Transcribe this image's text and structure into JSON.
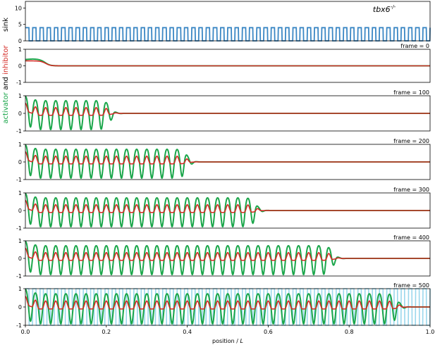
{
  "title": "tbx6",
  "title_superscript": "-/-",
  "colors": {
    "sink": "#3b87c4",
    "sink_light": "#8fd3ea",
    "activator": "#1aa64a",
    "inhibitor": "#d42a25",
    "axis": "#000000"
  },
  "ylabel_left": {
    "sink": "sink",
    "activator": "activator",
    "and": "and",
    "inhibitor": "inhibitor"
  },
  "chart_data": [
    {
      "type": "line",
      "panel": "sink",
      "ylim": [
        0,
        12
      ],
      "yticks": [
        "0",
        "5",
        "10"
      ],
      "series": [
        {
          "name": "sink",
          "pattern": "square-wave",
          "low": 0,
          "high": 4,
          "periods": 56,
          "x_range": [
            0.0,
            1.0
          ]
        }
      ]
    },
    {
      "type": "line",
      "panel": "frame",
      "frame_label": "frame = 0",
      "ylim": [
        -1,
        1
      ],
      "yticks": [
        "1",
        "0",
        "-1"
      ],
      "front": 0.05,
      "wavelength": 0.025
    },
    {
      "type": "line",
      "panel": "frame",
      "frame_label": "frame = 100",
      "ylim": [
        -1,
        1
      ],
      "yticks": [
        "1",
        "0",
        "-1"
      ],
      "front": 0.21,
      "wavelength": 0.025
    },
    {
      "type": "line",
      "panel": "frame",
      "frame_label": "frame = 200",
      "ylim": [
        -1,
        1
      ],
      "yticks": [
        "1",
        "0",
        "-1"
      ],
      "front": 0.4,
      "wavelength": 0.025
    },
    {
      "type": "line",
      "panel": "frame",
      "frame_label": "frame = 300",
      "ylim": [
        -1,
        1
      ],
      "yticks": [
        "1",
        "0",
        "-1"
      ],
      "front": 0.57,
      "wavelength": 0.025
    },
    {
      "type": "line",
      "panel": "frame",
      "frame_label": "frame = 400",
      "ylim": [
        -1,
        1
      ],
      "yticks": [
        "1",
        "0",
        "-1"
      ],
      "front": 0.76,
      "wavelength": 0.025
    },
    {
      "type": "line",
      "panel": "frame",
      "frame_label": "frame = 500",
      "ylim": [
        -1,
        1
      ],
      "yticks": [
        "1",
        "0",
        "-1"
      ],
      "front": 0.92,
      "wavelength": 0.025,
      "sink_overlay": true
    }
  ],
  "xaxis": {
    "label": "position / L",
    "label_text": "position / ",
    "label_var": "L",
    "ticks": [
      "0.0",
      "0.2",
      "0.4",
      "0.6",
      "0.8",
      "1.0"
    ],
    "xlim": [
      0.0,
      1.0
    ]
  }
}
